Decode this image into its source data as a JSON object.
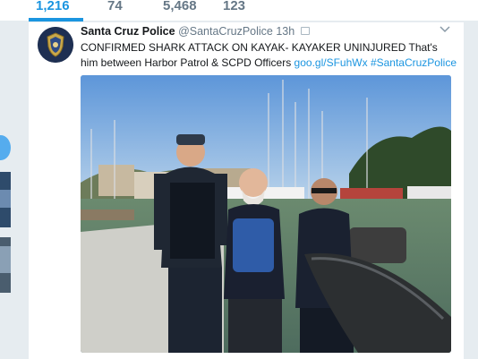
{
  "stats": [
    {
      "value": "1,216",
      "active": true
    },
    {
      "value": "74",
      "active": false
    },
    {
      "value": "5,468",
      "active": false
    },
    {
      "value": "123",
      "active": false
    }
  ],
  "tweet": {
    "name": "Santa Cruz Police",
    "handle": "@SantaCruzPolice",
    "time": "13h",
    "text_main": "CONFIRMED SHARK ATTACK ON KAYAK- KAYAKER UNINJURED That's him between Harbor Patrol & SCPD Officers",
    "link_url": "goo.gl/SFuhWx",
    "hashtag": "#SantaCruzPolice",
    "avatar_icon": "police-badge-icon",
    "menu_icon": "chevron-down-icon",
    "photo_caption": "",
    "colors": {
      "link": "#1b95e0",
      "name": "#14171a",
      "meta": "#657786"
    }
  }
}
